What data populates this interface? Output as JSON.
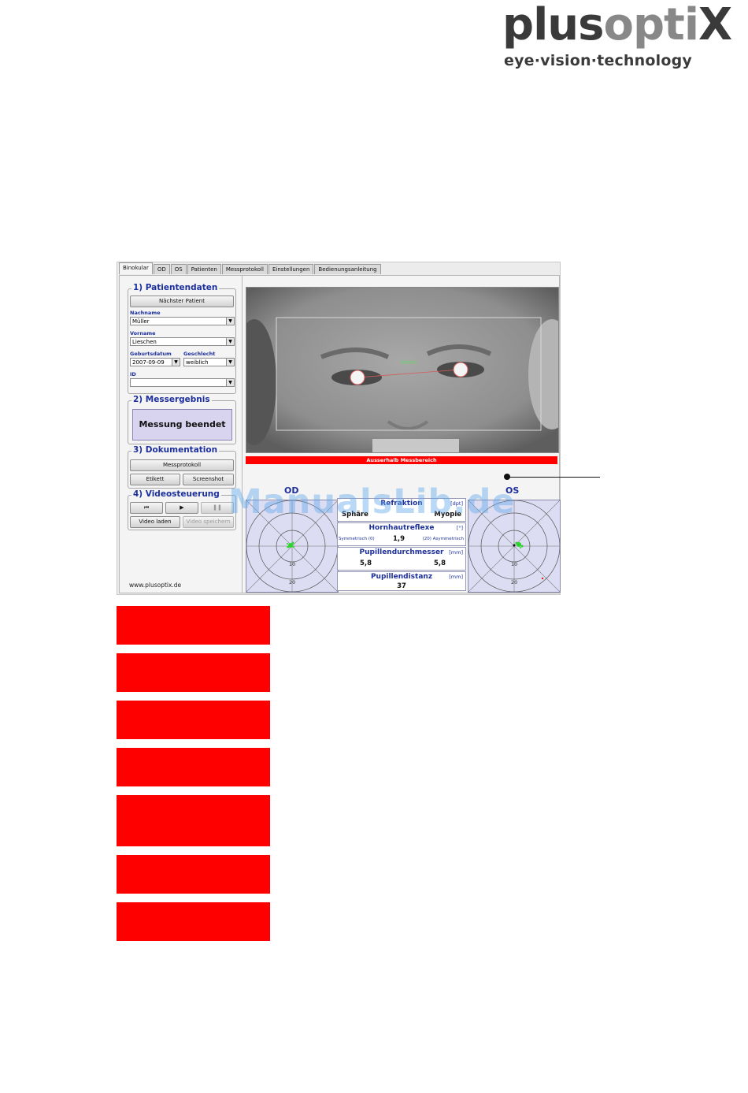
{
  "logo": {
    "word_a": "plus",
    "word_b": "opti",
    "word_c": "X",
    "tagline": "eye·vision·technology"
  },
  "tabs": [
    {
      "label": "Binokular",
      "active": true
    },
    {
      "label": "OD",
      "active": false
    },
    {
      "label": "OS",
      "active": false
    },
    {
      "label": "Patienten",
      "active": false
    },
    {
      "label": "Messprotokoll",
      "active": false
    },
    {
      "label": "Einstellungen",
      "active": false
    },
    {
      "label": "Bedienungsanleitung",
      "active": false
    }
  ],
  "patient": {
    "title": "1) Patientendaten",
    "next_button": "Nächster Patient",
    "lastname_label": "Nachname",
    "lastname_value": "Müller",
    "firstname_label": "Vorname",
    "firstname_value": "Lieschen",
    "birth_label": "Geburtsdatum",
    "birth_value": "2007-09-09",
    "gender_label": "Geschlecht",
    "gender_value": "weiblich",
    "id_label": "ID",
    "id_value": ""
  },
  "result": {
    "title": "2) Messergebnis",
    "status": "Messung beendet"
  },
  "documentation": {
    "title": "3) Dokumentation",
    "protocol_button": "Messprotokoll",
    "label_button": "Etikett",
    "screenshot_button": "Screenshot"
  },
  "video": {
    "title": "4) Videosteuerung",
    "rewind_icon": "⏮",
    "play_icon": "▶",
    "pause_icon": "❚❚",
    "load_button": "Video laden",
    "save_button": "Video speichern"
  },
  "website": "www.plusoptix.de",
  "camera": {
    "overlay_text": "Werte",
    "warning": "Ausserhalb Messbereich"
  },
  "od_label": "OD",
  "os_label": "OS",
  "target_ticks": {
    "t10": "10",
    "t20": "20"
  },
  "measurements": {
    "refraction": {
      "title": "Refraktion",
      "unit": "[dpt]",
      "left": "Sphäre",
      "right": "Myopie"
    },
    "corneal": {
      "title": "Hornhautreflexe",
      "unit": "[°]",
      "left_text": "Symmetrisch (0)",
      "right_text": "(20) Asymmetrisch",
      "value": "1,9"
    },
    "pupil_diameter": {
      "title": "Pupillendurchmesser",
      "unit": "[mm]",
      "od": "5,8",
      "os": "5,8"
    },
    "pupil_distance": {
      "title": "Pupillendistanz",
      "unit": "[mm]",
      "value": "37"
    }
  },
  "watermark": "ManualsLib.de",
  "colors": {
    "accent_blue": "#1c2f9c",
    "warning_red": "#ff0000",
    "status_bg": "#d8d4ef"
  }
}
